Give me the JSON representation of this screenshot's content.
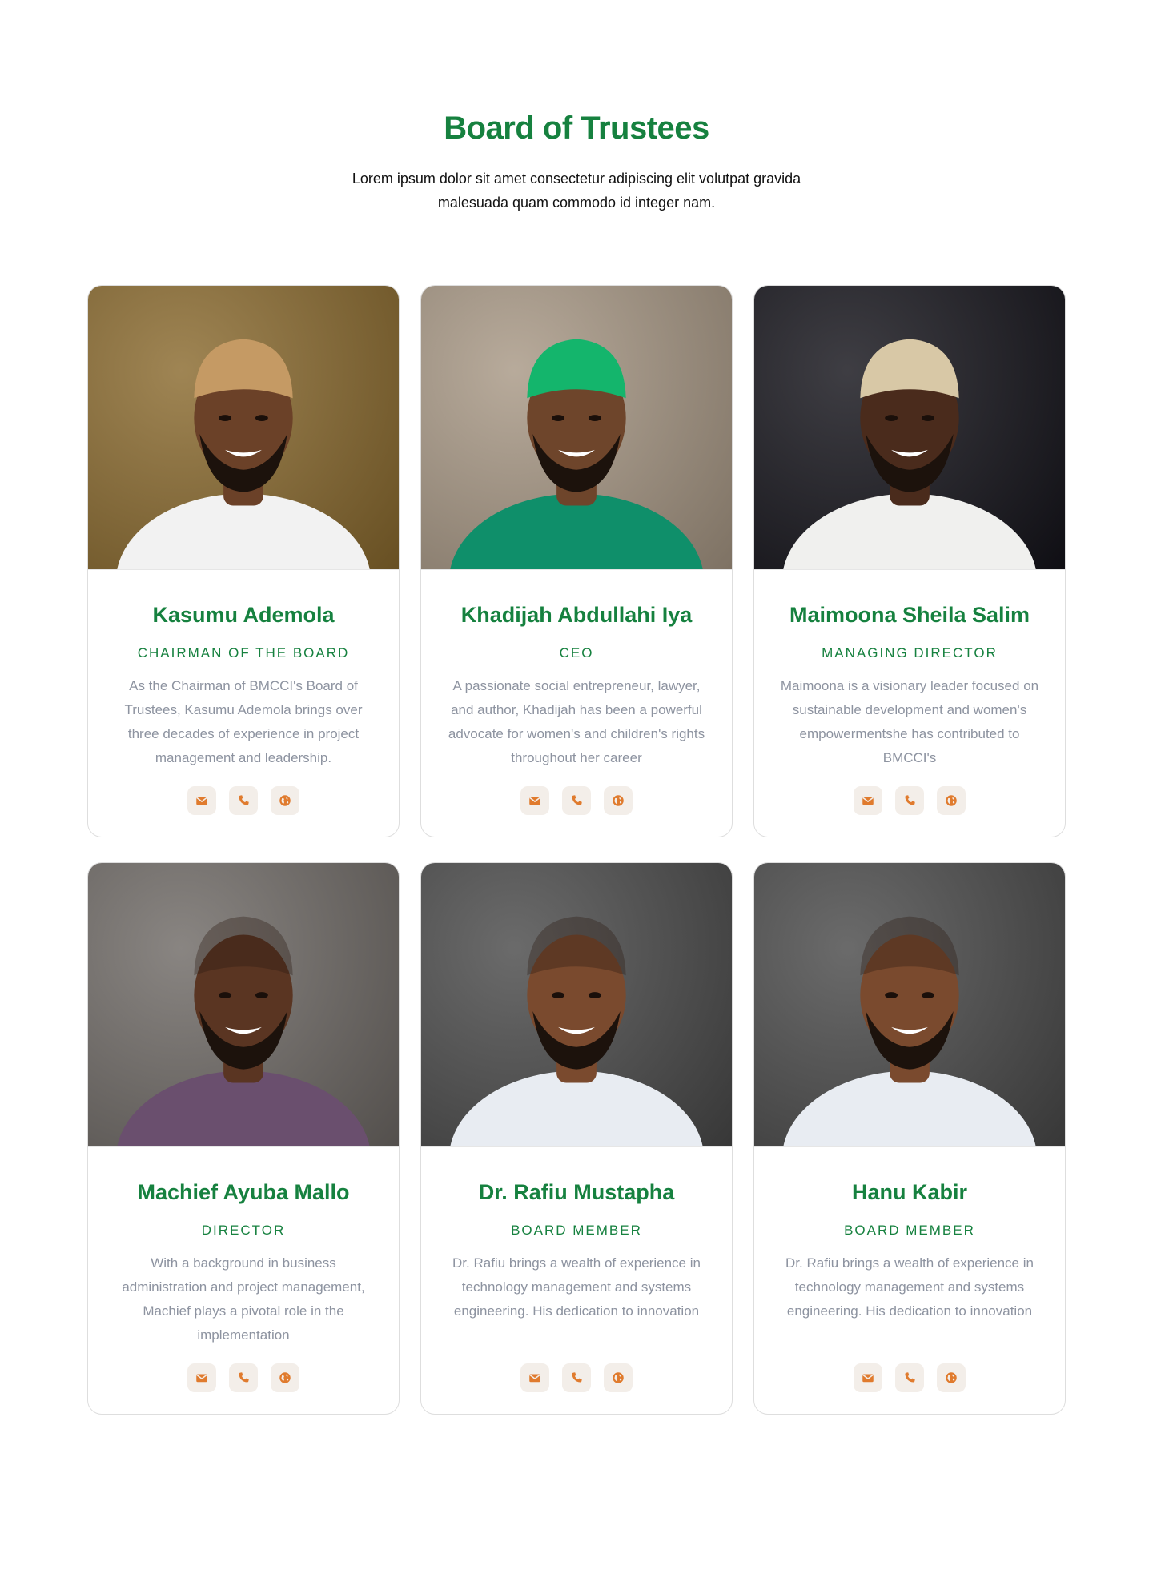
{
  "header": {
    "title": "Board of Trustees",
    "subtitle": "Lorem ipsum dolor sit amet consectetur adipiscing elit volutpat gravida malesuada quam commodo id integer nam."
  },
  "colors": {
    "accent_green": "#16813f",
    "icon_orange": "#e07b2e",
    "icon_bg": "#f3eee9",
    "bio_gray": "#8d93a0"
  },
  "trustees": [
    {
      "name": "Kasumu Ademola",
      "role": "CHAIRMAN OF THE BOARD",
      "bio": "As the Chairman of BMCCI's Board of Trustees, Kasumu Ademola brings over three decades of experience in project management and leadership.",
      "photo_bg": "#8a6a2e",
      "skin": "#6b4128",
      "clothing": "#f2f2f2",
      "headwear": "#c59a64",
      "icons": [
        "envelope-icon",
        "phone-icon",
        "globe-icon"
      ]
    },
    {
      "name": "Khadijah Abdullahi Iya",
      "role": "CEO",
      "bio": "A passionate social entrepreneur, lawyer, and author, Khadijah has been a powerful advocate for women's and children's rights throughout her career",
      "photo_bg": "#a89885",
      "skin": "#6e452b",
      "clothing": "#0f8f6a",
      "headwear": "#14b56c",
      "icons": [
        "envelope-icon",
        "phone-icon",
        "globe-icon"
      ]
    },
    {
      "name": "Maimoona Sheila Salim",
      "role": "MANAGING DIRECTOR",
      "bio": "Maimoona is a visionary leader focused on sustainable development and women's empowermentshe has contributed to BMCCI's",
      "photo_bg": "#14131a",
      "skin": "#4a2b1c",
      "clothing": "#f0f0ee",
      "headwear": "#d8c8a6",
      "icons": [
        "envelope-icon",
        "phone-icon",
        "globe-icon"
      ]
    },
    {
      "name": "Machief Ayuba Mallo",
      "role": "DIRECTOR",
      "bio": "With a background in business administration and project management, Machief plays a pivotal role in the implementation",
      "photo_bg": "#6f6a66",
      "skin": "#5a3522",
      "clothing": "#6a4f6e",
      "headwear": "",
      "icons": [
        "envelope-icon",
        "phone-icon",
        "globe-icon"
      ]
    },
    {
      "name": "Dr. Rafiu Mustapha",
      "role": "BOARD MEMBER",
      "bio": "Dr. Rafiu brings a wealth of experience in technology management and systems engineering. His dedication to innovation",
      "photo_bg": "#4a4a4a",
      "skin": "#7a4a2e",
      "clothing": "#e8ecf2",
      "headwear": "",
      "icons": [
        "envelope-icon",
        "phone-icon",
        "globe-icon"
      ]
    },
    {
      "name": "Hanu Kabir",
      "role": "BOARD MEMBER",
      "bio": "Dr. Rafiu brings a wealth of experience in technology management and systems engineering. His dedication to innovation",
      "photo_bg": "#4a4a4a",
      "skin": "#7a4a2e",
      "clothing": "#e8ecf2",
      "headwear": "",
      "icons": [
        "envelope-icon",
        "phone-icon",
        "globe-icon"
      ]
    }
  ]
}
